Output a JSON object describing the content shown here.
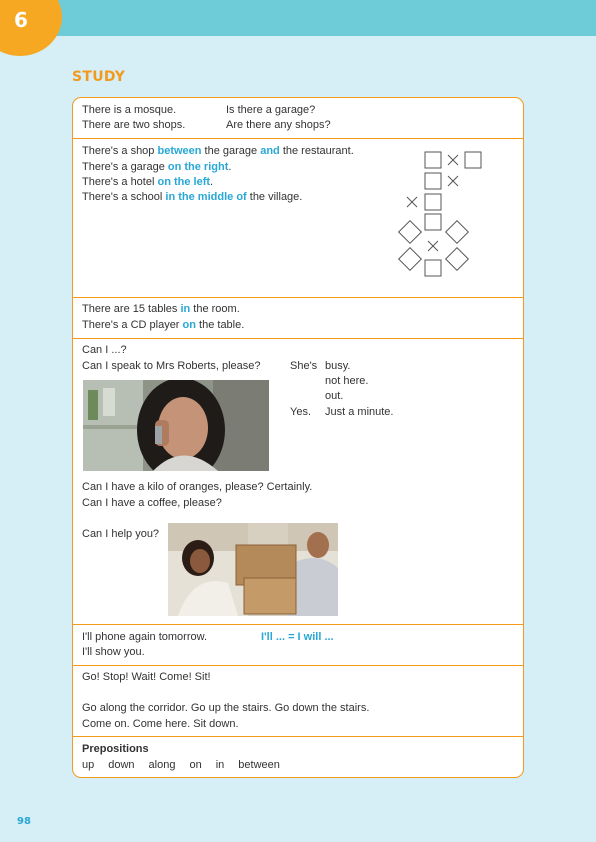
{
  "unit": {
    "number": "6"
  },
  "section": {
    "title": "STUDY"
  },
  "page_number": "98",
  "block_there_is": {
    "col1": [
      "There is a mosque.",
      "There are two shops."
    ],
    "col2": [
      "Is there a garage?",
      "Are there any shops?"
    ]
  },
  "block_location": {
    "line1": {
      "a": "There's a shop ",
      "b": "between",
      "c": " the garage ",
      "d": "and",
      "e": " the restaurant."
    },
    "line2": {
      "a": "There's a garage ",
      "b": "on the right",
      "c": "."
    },
    "line3": {
      "a": "There's a hotel ",
      "b": "on the left",
      "c": "."
    },
    "line4": {
      "a": "There's a school ",
      "b": "in the middle of",
      "c": " the village."
    }
  },
  "block_in_on": {
    "line1": {
      "a": "There are 15 tables ",
      "b": "in",
      "c": " the room."
    },
    "line2": {
      "a": "There's a CD player ",
      "b": "on",
      "c": " the table."
    }
  },
  "block_can": {
    "heading": "Can I ...?",
    "question": "Can I speak to Mrs Roberts, please?",
    "answer_prefix_1": "She's",
    "answers": [
      "busy.",
      "not here.",
      "out.",
      "Just a minute."
    ],
    "answer_prefix_4": "Yes.",
    "line_oranges": "Can I have a kilo of oranges, please? Certainly.",
    "line_coffee": "Can I have a coffee, please?",
    "line_help": "Can I help you?"
  },
  "block_will": {
    "line1": "I'll phone again tomorrow.",
    "line2": "I'll show you.",
    "rule": "I'll ... = I will ..."
  },
  "block_imperatives": {
    "line1": "Go! Stop! Wait! Come! Sit!",
    "line2": "Go along the corridor. Go up the stairs. Go down the stairs.",
    "line3": "Come on. Come here. Sit down."
  },
  "block_prepositions": {
    "heading": "Prepositions",
    "items": [
      "up",
      "down",
      "along",
      "on",
      "in",
      "between"
    ]
  },
  "colors": {
    "accent_orange": "#f39a1e",
    "accent_blue": "#28a8d6",
    "band": "#6ecbd8",
    "page_bg": "#d6eef5"
  }
}
